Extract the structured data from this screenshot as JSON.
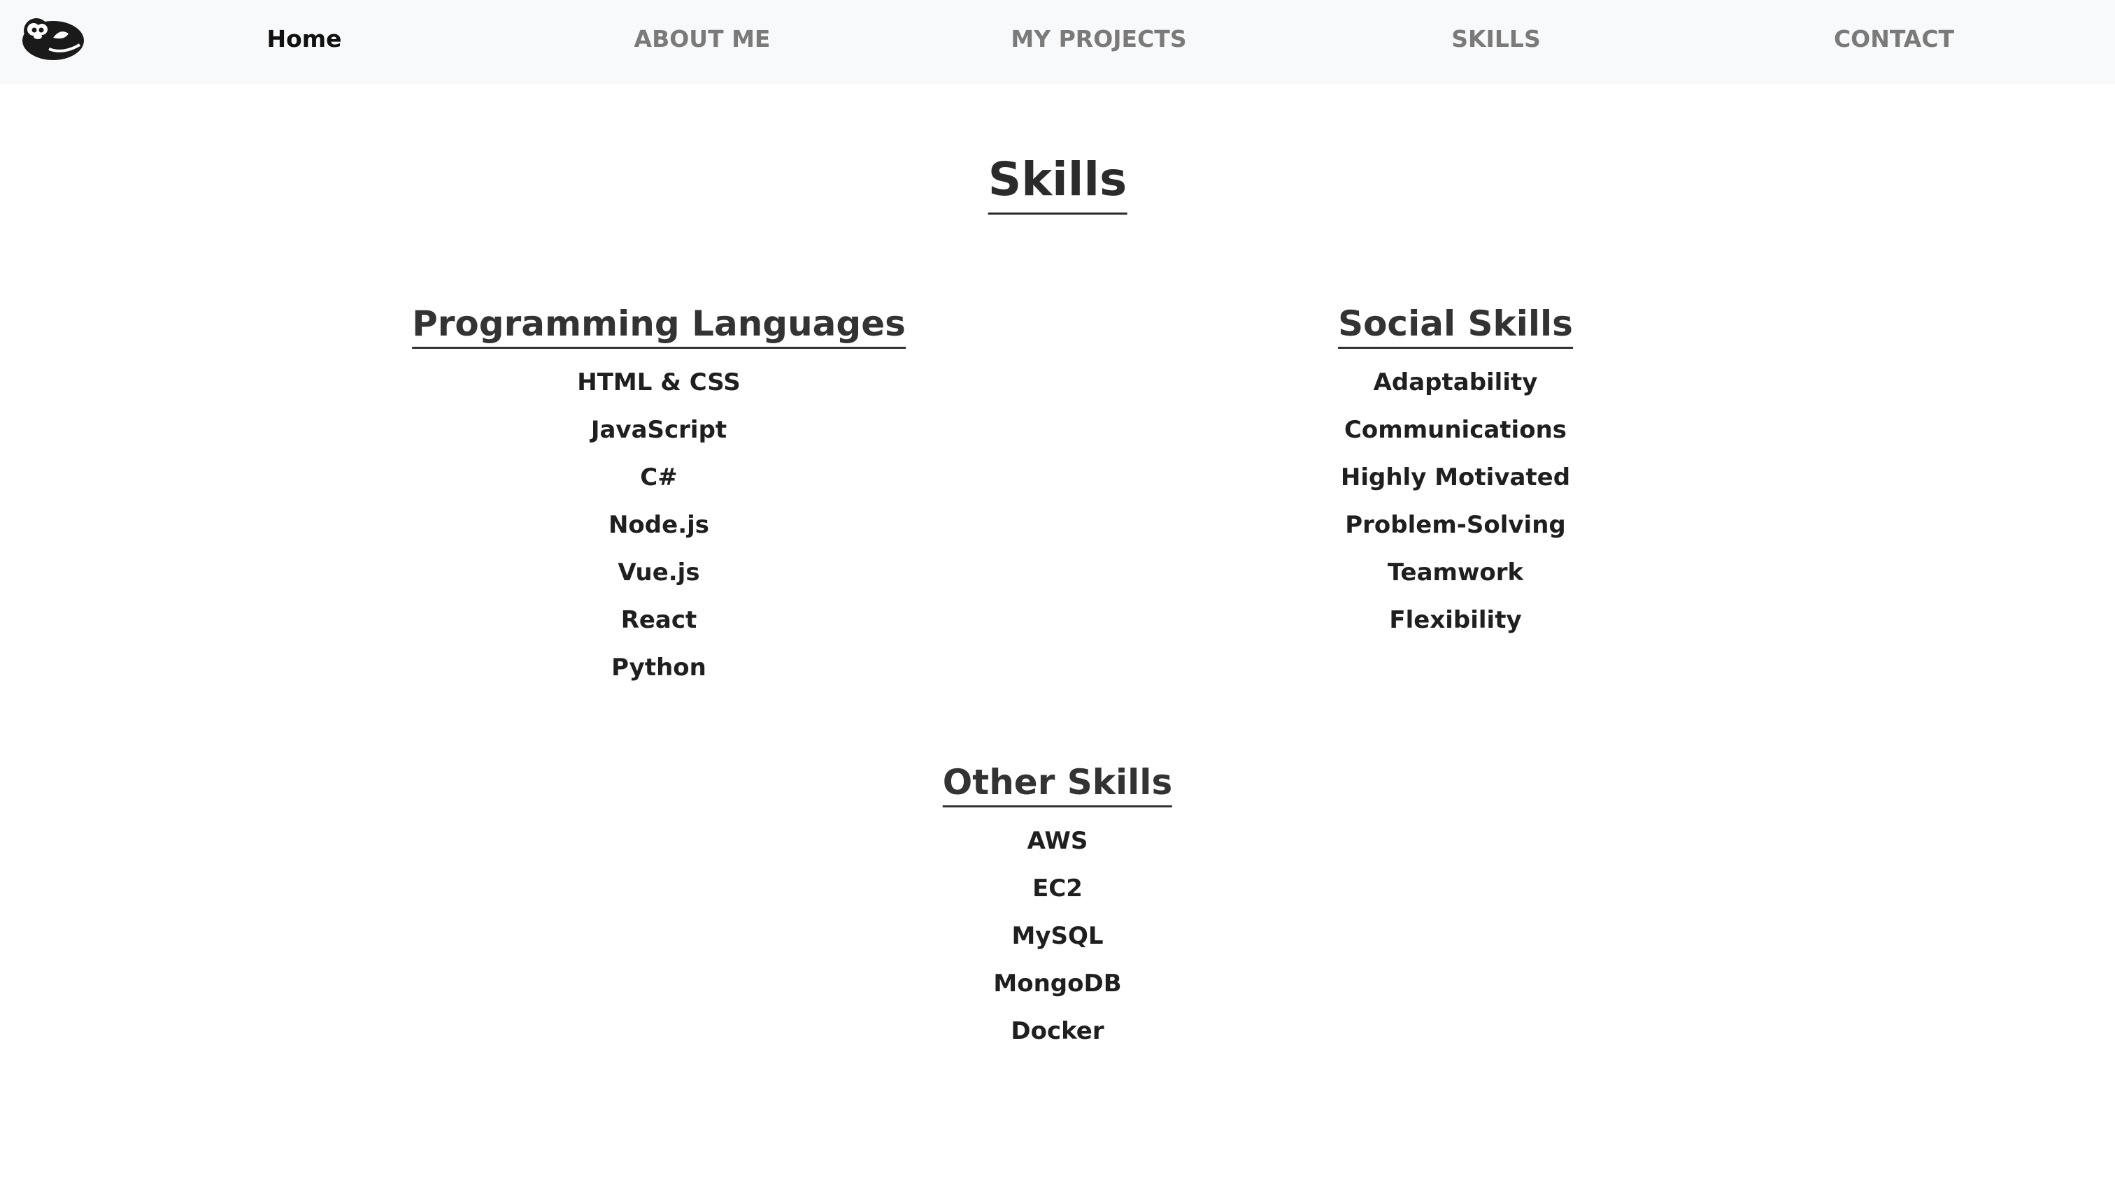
{
  "nav": {
    "logo_icon": "otter-logo-icon",
    "links": [
      {
        "label": "Home",
        "active": true
      },
      {
        "label": "ABOUT ME",
        "active": false
      },
      {
        "label": "MY PROJECTS",
        "active": false
      },
      {
        "label": "SKILLS",
        "active": false
      },
      {
        "label": "CONTACT",
        "active": false
      }
    ]
  },
  "page": {
    "title": "Skills"
  },
  "sections": {
    "programming": {
      "title": "Programming Languages",
      "items": [
        "HTML & CSS",
        "JavaScript",
        "C#",
        "Node.js",
        "Vue.js",
        "React",
        "Python"
      ]
    },
    "social": {
      "title": "Social Skills",
      "items": [
        "Adaptability",
        "Communications",
        "Highly Motivated",
        "Problem-Solving",
        "Teamwork",
        "Flexibility"
      ]
    },
    "other": {
      "title": "Other Skills",
      "items": [
        "AWS",
        "EC2",
        "MySQL",
        "MongoDB",
        "Docker"
      ]
    }
  },
  "colors": {
    "navbar_bg": "#f8f9fa",
    "nav_inactive": "#7a7a7a",
    "nav_active": "#111111",
    "heading": "#2b2b2b"
  }
}
